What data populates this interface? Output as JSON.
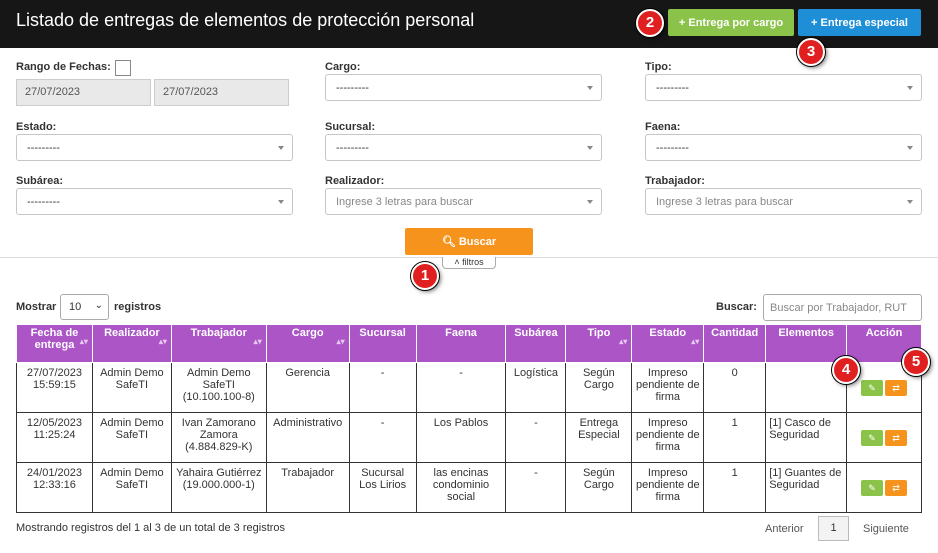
{
  "header": {
    "title": "Listado de entregas de elementos de protección personal",
    "btn_cargo": "Entrega por cargo",
    "btn_especial": "Entrega especial"
  },
  "badges": [
    "1",
    "2",
    "3",
    "4",
    "5"
  ],
  "filters": {
    "rango_label": "Rango de Fechas:",
    "date_from": "27/07/2023",
    "date_to": "27/07/2023",
    "cargo_label": "Cargo:",
    "cargo_value": "---------",
    "tipo_label": "Tipo:",
    "tipo_value": "---------",
    "estado_label": "Estado:",
    "estado_value": "---------",
    "sucursal_label": "Sucursal:",
    "sucursal_value": "---------",
    "faena_label": "Faena:",
    "faena_value": "---------",
    "subarea_label": "Subárea:",
    "subarea_value": "---------",
    "realizador_label": "Realizador:",
    "realizador_placeholder": "Ingrese 3 letras para buscar",
    "trabajador_label": "Trabajador:",
    "trabajador_placeholder": "Ingrese 3 letras para buscar",
    "buscar_btn": "Buscar",
    "filtros_toggle": "filtros"
  },
  "table_controls": {
    "mostrar": "Mostrar",
    "length": "10",
    "registros": "registros",
    "buscar_label": "Buscar:",
    "search_placeholder": "Buscar por Trabajador, RUT"
  },
  "columns": [
    "Fecha de entrega",
    "Realizador",
    "Trabajador",
    "Cargo",
    "Sucursal",
    "Faena",
    "Subárea",
    "Tipo",
    "Estado",
    "Cantidad",
    "Elementos",
    "Acción"
  ],
  "rows": [
    [
      "27/07/2023 15:59:15",
      "Admin Demo SafeTI",
      "Admin Demo SafeTI (10.100.100-8)",
      "Gerencia",
      "-",
      "-",
      "Logística",
      "Según Cargo",
      "Impreso pendiente de firma",
      "0",
      ""
    ],
    [
      "12/05/2023 11:25:24",
      "Admin Demo SafeTI",
      "Ivan Zamorano Zamora (4.884.829-K)",
      "Administrativo",
      "-",
      "Los Pablos",
      "-",
      "Entrega Especial",
      "Impreso pendiente de firma",
      "1",
      "[1] Casco de Seguridad"
    ],
    [
      "24/01/2023 12:33:16",
      "Admin Demo SafeTI",
      "Yahaira Gutiérrez (19.000.000-1)",
      "Trabajador",
      "Sucursal Los Lirios",
      "las encinas condominio social",
      "-",
      "Según Cargo",
      "Impreso pendiente de firma",
      "1",
      "[1] Guantes de Seguridad"
    ]
  ],
  "footer": {
    "info": "Mostrando registros del 1 al 3 de un total de 3 registros",
    "prev": "Anterior",
    "page": "1",
    "next": "Siguiente"
  }
}
